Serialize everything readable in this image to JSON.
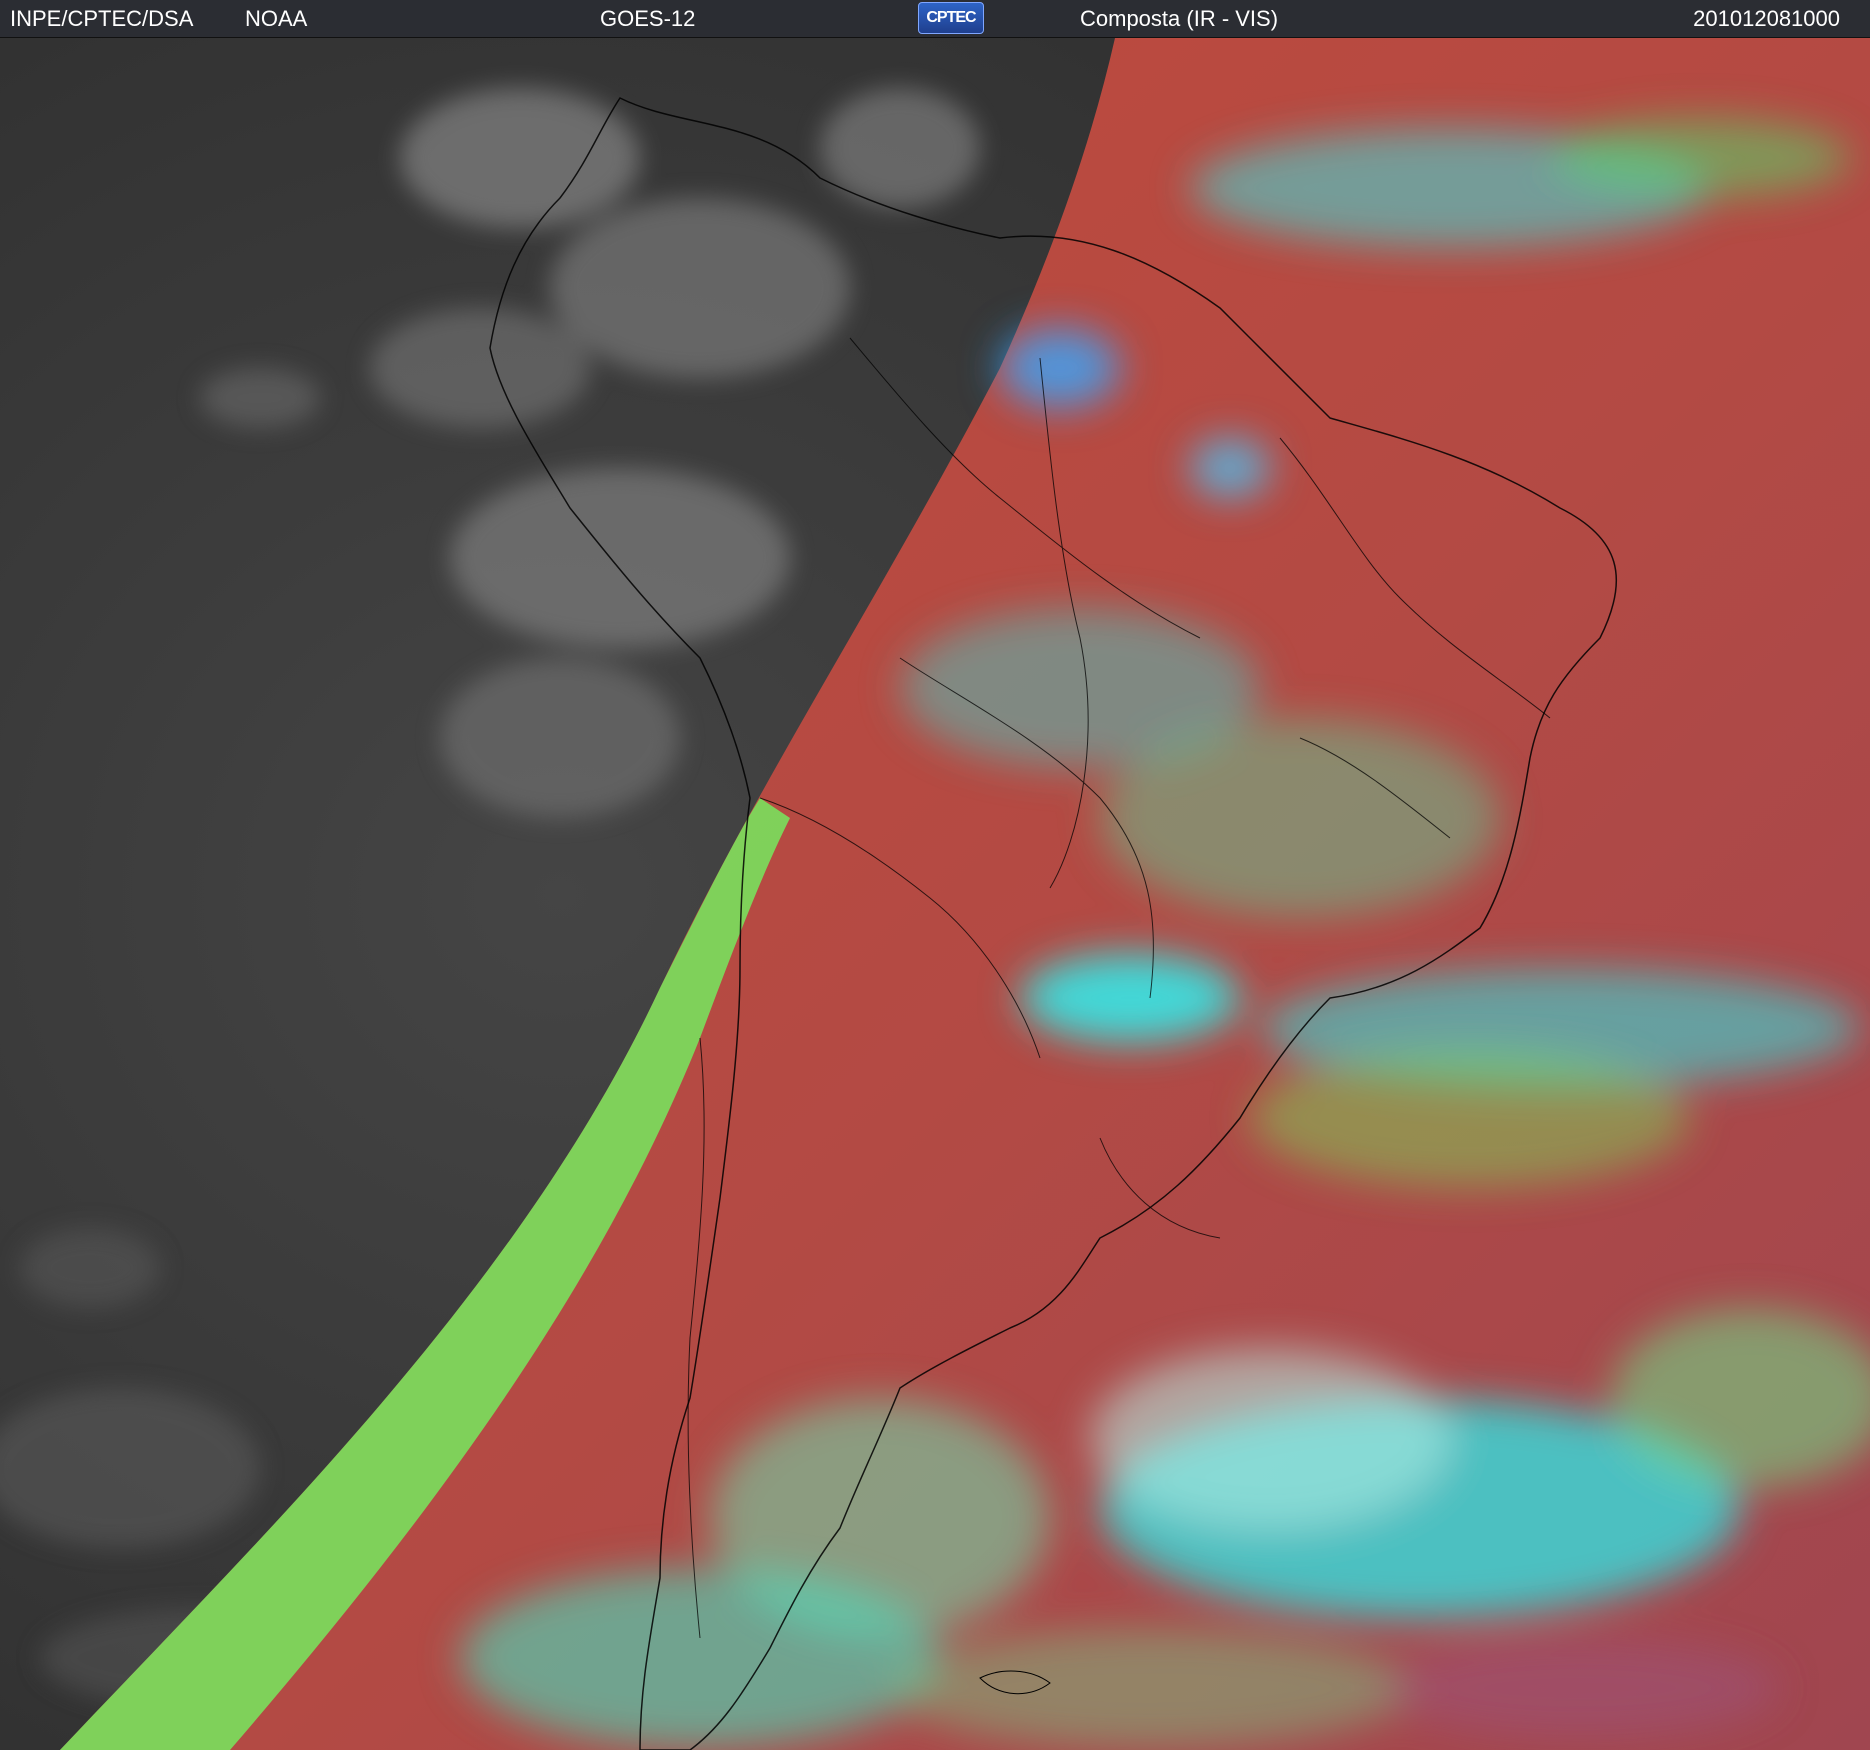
{
  "header": {
    "institution": "INPE/CPTEC/DSA",
    "agency": "NOAA",
    "satellite": "GOES-12",
    "logo_text": "CPTEC",
    "product": "Composta (IR - VIS)",
    "timestamp": "201012081000"
  },
  "colors": {
    "header_bg": "#2b2d33",
    "night_ir": "#3d3d3d",
    "terminator_green": "#7bdc5c",
    "land_red": "#b8493f",
    "ocean_red": "#c04a3a",
    "cloud_cyan": "#2ee8e8",
    "coastline": "#000000"
  }
}
